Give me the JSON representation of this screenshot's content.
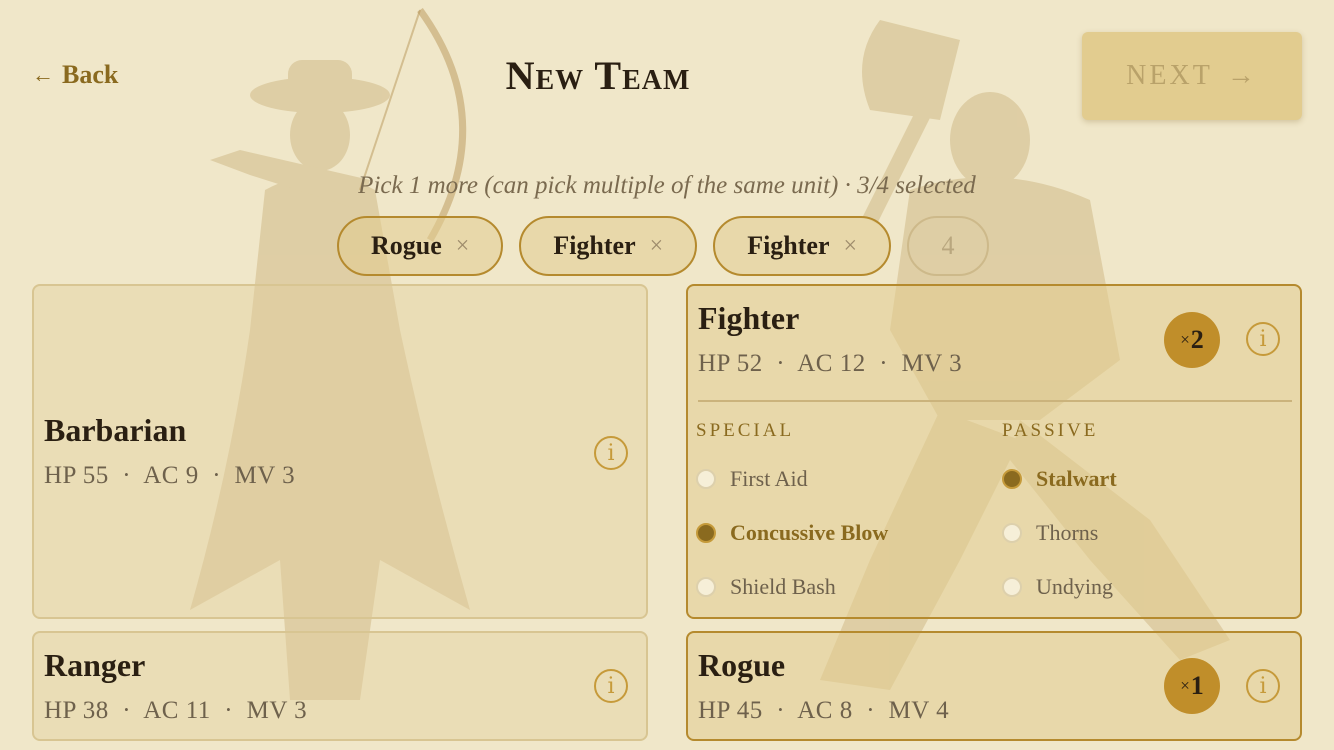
{
  "header": {
    "back_label": "Back",
    "back_arrow": "←",
    "title": "New Team",
    "next_label": "NEXT",
    "next_arrow": "→"
  },
  "subtitle": "Pick 1 more (can pick multiple of the same unit) · 3/4 selected",
  "chips": [
    {
      "label": "Rogue",
      "remove": "×"
    },
    {
      "label": "Fighter",
      "remove": "×"
    },
    {
      "label": "Fighter",
      "remove": "×"
    },
    {
      "label": "4"
    }
  ],
  "cards": {
    "barbarian": {
      "name": "Barbarian",
      "stats": "HP 55  ·  AC 9  ·  MV 3",
      "info": "i"
    },
    "fighter": {
      "name": "Fighter",
      "stats": "HP 52  ·  AC 12  ·  MV 3",
      "count_prefix": "×",
      "count": "2",
      "info": "i",
      "special_heading": "SPECIAL",
      "passive_heading": "PASSIVE",
      "special": [
        "First Aid",
        "Concussive Blow",
        "Shield Bash"
      ],
      "special_selected": "Concussive Blow",
      "passive": [
        "Stalwart",
        "Thorns",
        "Undying"
      ],
      "passive_selected": "Stalwart"
    },
    "ranger": {
      "name": "Ranger",
      "stats": "HP 38  ·  AC 11  ·  MV 3",
      "info": "i"
    },
    "rogue": {
      "name": "Rogue",
      "stats": "HP 45  ·  AC 8  ·  MV 4",
      "count_prefix": "×",
      "count": "1",
      "info": "i"
    }
  },
  "colors": {
    "background": "#f0e7c9",
    "accent": "#c08e2a",
    "accent_dark": "#8a6a1f",
    "text": "#2a1f12"
  }
}
